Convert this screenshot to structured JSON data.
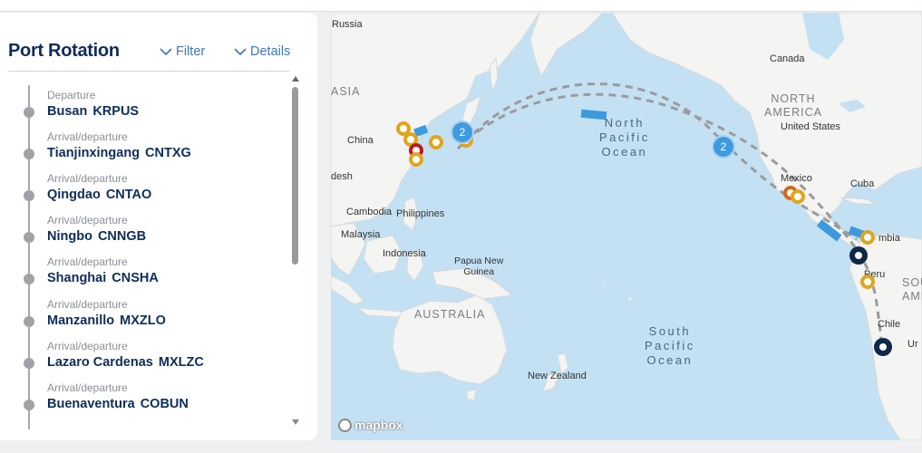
{
  "panel": {
    "title": "Port Rotation",
    "filter_label": "Filter",
    "details_label": "Details"
  },
  "stops": [
    {
      "type": "Departure",
      "port": "Busan",
      "code": "KRPUS"
    },
    {
      "type": "Arrival/departure",
      "port": "Tianjinxingang",
      "code": "CNTXG"
    },
    {
      "type": "Arrival/departure",
      "port": "Qingdao",
      "code": "CNTAO"
    },
    {
      "type": "Arrival/departure",
      "port": "Ningbo",
      "code": "CNNGB"
    },
    {
      "type": "Arrival/departure",
      "port": "Shanghai",
      "code": "CNSHA"
    },
    {
      "type": "Arrival/departure",
      "port": "Manzanillo",
      "code": "MXZLO"
    },
    {
      "type": "Arrival/departure",
      "port": "Lazaro Cardenas",
      "code": "MXLZC"
    },
    {
      "type": "Arrival/departure",
      "port": "Buenaventura",
      "code": "COBUN"
    }
  ],
  "map": {
    "labels": {
      "russia": "Russia",
      "asia": "ASIA",
      "china": "China",
      "bangladesh": "desh",
      "cambodia": "Cambodia",
      "philippines": "Philippines",
      "malaysia": "Malaysia",
      "indonesia": "Indonesia",
      "papua": "Papua New\nGuinea",
      "australia": "AUSTRALIA",
      "new_zealand": "New Zealand",
      "canada": "Canada",
      "north_america": "NORTH\nAMERICA",
      "united_states": "United States",
      "mexico": "Mexico",
      "cuba": "Cuba",
      "colombia": "mbia",
      "peru": "Peru",
      "chile": "Chile",
      "uruguay": "Ur",
      "south_america": "SOU\nAME",
      "north_pacific": "North\nPacific\nOcean",
      "south_pacific": "South\nPacific\nOcean"
    },
    "clusters": [
      "2",
      "2"
    ],
    "attribution": "mapbox",
    "colors": {
      "route": "#9b9b9b",
      "vessel": "#3b9ae0",
      "port_pin": "#e0a51c",
      "active_pin": "#0f2848",
      "highlight_port": "#b91c1c"
    }
  }
}
